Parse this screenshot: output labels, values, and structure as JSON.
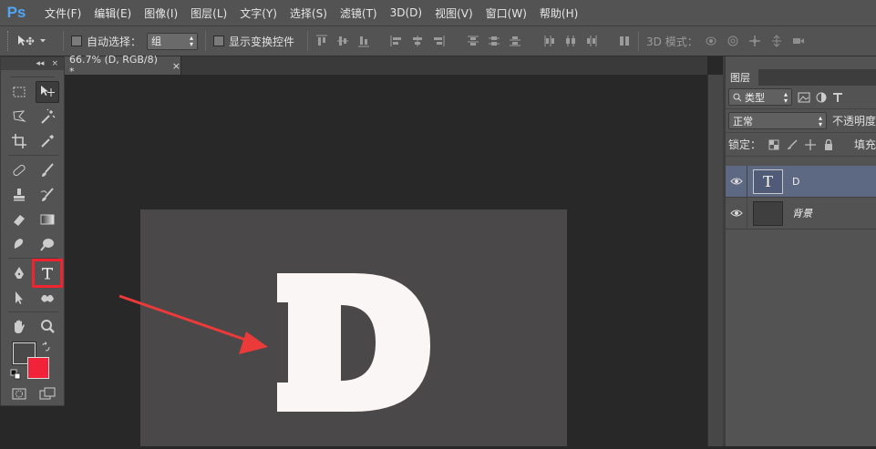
{
  "app": {
    "logo": "Ps"
  },
  "menu": [
    "文件(F)",
    "编辑(E)",
    "图像(I)",
    "图层(L)",
    "文字(Y)",
    "选择(S)",
    "滤镜(T)",
    "3D(D)",
    "视图(V)",
    "窗口(W)",
    "帮助(H)"
  ],
  "options": {
    "auto_select_label": "自动选择：",
    "auto_select_value": "组",
    "show_transform_label": "显示变换控件",
    "mode_3d_label": "3D 模式："
  },
  "document": {
    "tab_title": "66.7% (D, RGB/8) *",
    "tab_close": "×",
    "canvas_color": "#4a4849",
    "letter": "D",
    "letter_color": "#fbf6f6",
    "arrow_color": "#ea3a3a"
  },
  "toolbox": {
    "header_collapse": "◂◂",
    "header_close": "×",
    "highlighted_tool": "type-tool",
    "highlight_color": "#f0232e",
    "foreground_color": "#4a4a4a",
    "background_color": "#f2223a"
  },
  "layers_panel": {
    "tab_label": "图层",
    "filter_label": "类型",
    "blend_mode": "正常",
    "opacity_label": "不透明度",
    "lock_label": "锁定：",
    "fill_label": "填充",
    "layers": [
      {
        "name": "D",
        "type": "text",
        "selected": true,
        "thumb_glyph": "T"
      },
      {
        "name": "背景",
        "type": "background",
        "selected": false
      }
    ]
  }
}
